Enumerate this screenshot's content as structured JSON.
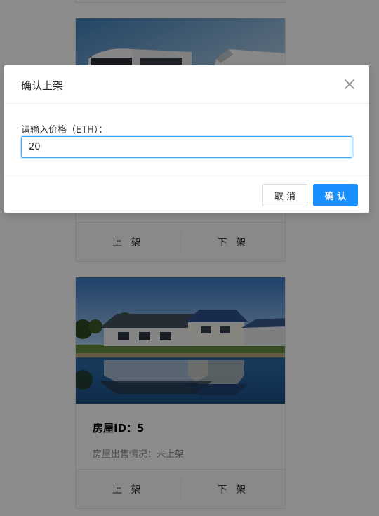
{
  "listing": {
    "card1": {
      "actions": {
        "list_label": "上 架",
        "delist_label": "下 架"
      }
    },
    "card2": {
      "title": "房屋ID：5",
      "status": "房屋出售情况：未上架",
      "actions": {
        "list_label": "上 架",
        "delist_label": "下 架"
      }
    }
  },
  "modal": {
    "title": "确认上架",
    "field_label": "请输入价格（ETH）：",
    "price_value": "20",
    "cancel_label": "取 消",
    "ok_label": "确 认"
  }
}
